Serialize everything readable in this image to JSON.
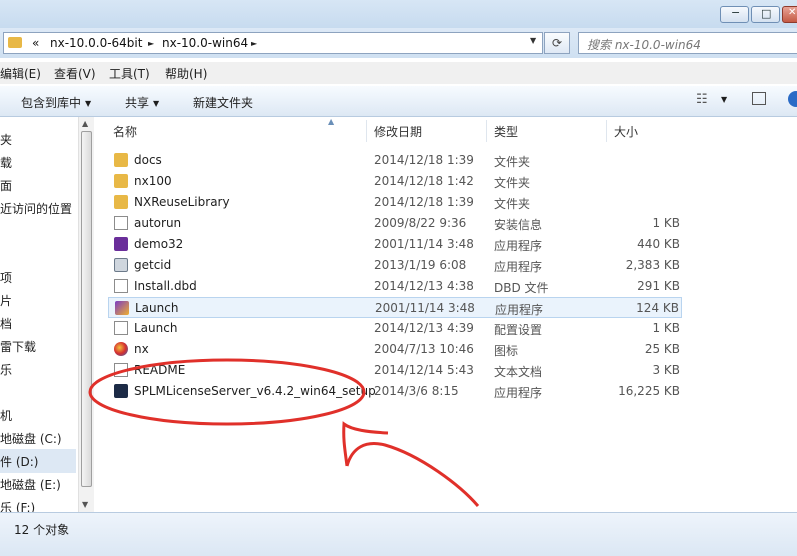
{
  "address": {
    "segments": [
      "«",
      "nx-10.0.0-64bit",
      "nx-10.0-win64"
    ],
    "separator": "►",
    "dropdown_icon": "refresh-icon"
  },
  "search": {
    "placeholder": "搜索 nx-10.0-win64"
  },
  "window_controls": {
    "minimize": "−",
    "maximize": "□",
    "close": "✕"
  },
  "menu": [
    "编辑(E)",
    "查看(V)",
    "工具(T)",
    "帮助(H)"
  ],
  "toolbar": {
    "include_in_library": "包含到库中",
    "share": "共享",
    "new_folder": "新建文件夹",
    "view_icon": "view-options-icon",
    "preview_icon": "preview-pane-icon",
    "help_icon": "help-icon"
  },
  "nav": [
    "夹",
    "载",
    "面",
    "近访问的位置",
    "项",
    "片",
    "档",
    "雷下载",
    "乐",
    "机",
    "地磁盘 (C:)",
    "件 (D:)",
    "地磁盘 (E:)",
    "乐 (F:)"
  ],
  "columns": {
    "name": "名称",
    "date": "修改日期",
    "type": "类型",
    "size": "大小"
  },
  "files": [
    {
      "name": "docs",
      "date": "2014/12/18 1:39",
      "type": "文件夹",
      "size": "",
      "icon": "folder-icon"
    },
    {
      "name": "nx100",
      "date": "2014/12/18 1:42",
      "type": "文件夹",
      "size": "",
      "icon": "folder-icon"
    },
    {
      "name": "NXReuseLibrary",
      "date": "2014/12/18 1:39",
      "type": "文件夹",
      "size": "",
      "icon": "folder-icon"
    },
    {
      "name": "autorun",
      "date": "2009/8/22 9:36",
      "type": "安装信息",
      "size": "1 KB",
      "icon": "setup-info-icon"
    },
    {
      "name": "demo32",
      "date": "2001/11/14 3:48",
      "type": "应用程序",
      "size": "440 KB",
      "icon": "application-icon"
    },
    {
      "name": "getcid",
      "date": "2013/1/19 6:08",
      "type": "应用程序",
      "size": "2,383 KB",
      "icon": "application-icon"
    },
    {
      "name": "Install.dbd",
      "date": "2014/12/13 4:38",
      "type": "DBD 文件",
      "size": "291 KB",
      "icon": "file-icon"
    },
    {
      "name": "Launch",
      "date": "2001/11/14 3:48",
      "type": "应用程序",
      "size": "124 KB",
      "icon": "application-icon"
    },
    {
      "name": "Launch",
      "date": "2014/12/13 4:39",
      "type": "配置设置",
      "size": "1 KB",
      "icon": "config-file-icon"
    },
    {
      "name": "nx",
      "date": "2004/7/13 10:46",
      "type": "图标",
      "size": "25 KB",
      "icon": "nx-icon"
    },
    {
      "name": "README",
      "date": "2014/12/14 5:43",
      "type": "文本文档",
      "size": "3 KB",
      "icon": "text-file-icon"
    },
    {
      "name": "SPLMLicenseServer_v6.4.2_win64_setup",
      "date": "2014/3/6 8:15",
      "type": "应用程序",
      "size": "16,225 KB",
      "icon": "installer-icon"
    }
  ],
  "status": {
    "count": "12 个对象"
  },
  "colors": {
    "annotation": "#e0302a",
    "selection": "#dde8f4",
    "hover": "#eaf3fc"
  }
}
